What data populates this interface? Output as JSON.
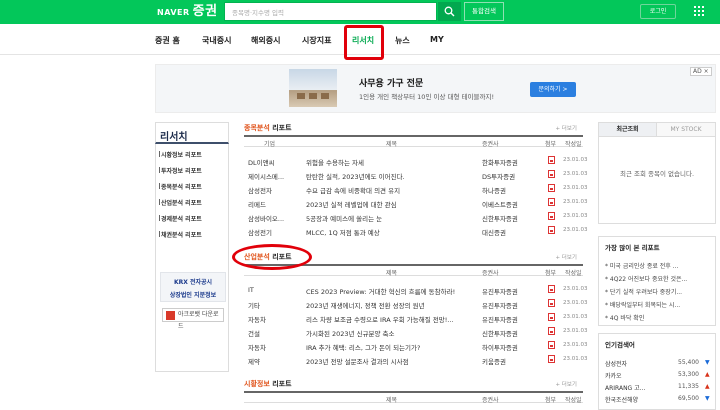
{
  "header": {
    "logo": "NAVER",
    "logo_big": "증권",
    "search_placeholder": "종목명·지수명 입력",
    "total_search": "통합검색",
    "login": "로그인"
  },
  "gnb": [
    "증권 홈",
    "국내증시",
    "해외증시",
    "시장지표",
    "리서치",
    "뉴스",
    "MY"
  ],
  "ad": {
    "title": "사무용 가구 전문",
    "desc": "1인용 개인 책상부터 10인 이상 대형 테이블까지!",
    "button": "문의하기 >",
    "tag": "AD ×"
  },
  "sidebar": {
    "title": "리서치",
    "items": [
      "시황정보 리포트",
      "투자정보 리포트",
      "종목분석 리포트",
      "산업분석 리포트",
      "경제분석 리포트",
      "채권분석 리포트"
    ],
    "krx1": "KRX 전자공시",
    "krx2": "상장법인 지분정보",
    "download": "아크로뱃 다운로드"
  },
  "stock_section": {
    "title_hl": "종목분석",
    "title_rest": " 리포트",
    "more": "+ 더보기",
    "headers": [
      "기업",
      "제목",
      "증권사",
      "첨부",
      "작성일"
    ],
    "rows": [
      [
        "DL이앤씨",
        "위험을 수용하는 자세",
        "한화투자증권",
        "23.01.03"
      ],
      [
        "제이시스메...",
        "탄탄한 실적, 2023년에도 이어진다.",
        "DS투자증권",
        "23.01.03"
      ],
      [
        "삼성전자",
        "수요 급감 속에 비중확대 의견 유지",
        "하나증권",
        "23.01.03"
      ],
      [
        "리메드",
        "2023년 실적 레벨업에 대한 관심",
        "이베스트증권",
        "23.01.03"
      ],
      [
        "삼성바이오...",
        "5공장과 예미스에 쏠리는 눈",
        "신한투자증권",
        "23.01.03"
      ],
      [
        "삼성전기",
        "MLCC, 1Q 저점 통과 예상",
        "대신증권",
        "23.01.03"
      ]
    ]
  },
  "industry_section": {
    "title_hl": "산업분석",
    "title_rest": " 리포트",
    "more": "+ 더보기",
    "headers": [
      "제목",
      "증권사",
      "첨부",
      "작성일"
    ],
    "rows": [
      [
        "IT",
        "CES 2023 Preview: 거대한 혁신의 흐름에 동참하라!",
        "유진투자증권",
        "23.01.03"
      ],
      [
        "기타",
        "2023년 재생에너지, 정책 전환 성장의 원년",
        "유진투자증권",
        "23.01.03"
      ],
      [
        "자동차",
        "리스 차량 보조금 수령으로 IRA 우회 가능해질 전망!...",
        "유진투자증권",
        "23.01.03"
      ],
      [
        "건설",
        "가시화된 2023년 신규분양 축소",
        "신한투자증권",
        "23.01.03"
      ],
      [
        "자동차",
        "IRA 추가 혜택: 리스, 그가 돈이 되는기가?",
        "하이투자증권",
        "23.01.03"
      ],
      [
        "제약",
        "2023년 전망 설문조사 결과의 시사점",
        "키움증권",
        "23.01.03"
      ]
    ]
  },
  "market_section": {
    "title_hl": "시황정보",
    "title_rest": " 리포트",
    "more": "+ 더보기",
    "headers": [
      "제목",
      "증권사",
      "첨부",
      "작성일"
    ]
  },
  "right": {
    "tab_recent": "최근조회",
    "tab_mystock": "MY STOCK",
    "empty": "최근 조회 종목이 없습니다.",
    "popular_title": "가장 많이 본 리포트",
    "popular": [
      "* 미국 금리인상 종료 전후 ...",
      "* 4Q22 어진보다 중요한 것은...",
      "* 단기 실적 우려보다 중장기...",
      "* 배당락일부터 회복되는 시...",
      "* 4Q 바닥 확인"
    ],
    "stock_title": "인기검색어",
    "stocks": [
      {
        "name": "삼성전자",
        "price": "55,400",
        "dir": "▼",
        "color": "#1a6ad8"
      },
      {
        "name": "카카오",
        "price": "53,300",
        "dir": "▲",
        "color": "#d8321a"
      },
      {
        "name": "ARIRANG 고...",
        "price": "11,335",
        "dir": "▲",
        "color": "#d8321a"
      },
      {
        "name": "한국조선해양",
        "price": "69,500",
        "dir": "▼",
        "color": "#1a6ad8"
      }
    ]
  }
}
